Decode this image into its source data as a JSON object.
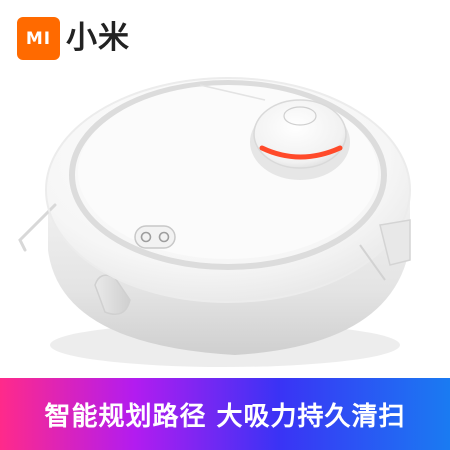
{
  "brand": {
    "logo_text": "MI",
    "name": "小米",
    "logo_color": "#ff6a00"
  },
  "product": {
    "subject": "robot vacuum cleaner",
    "accent_color": "#ff4a2a"
  },
  "banner": {
    "text": "智能规划路径  大吸力持久清扫",
    "gradient": [
      "#ff2a8a",
      "#b21cf0",
      "#3a33f5",
      "#1a7bf2"
    ]
  }
}
